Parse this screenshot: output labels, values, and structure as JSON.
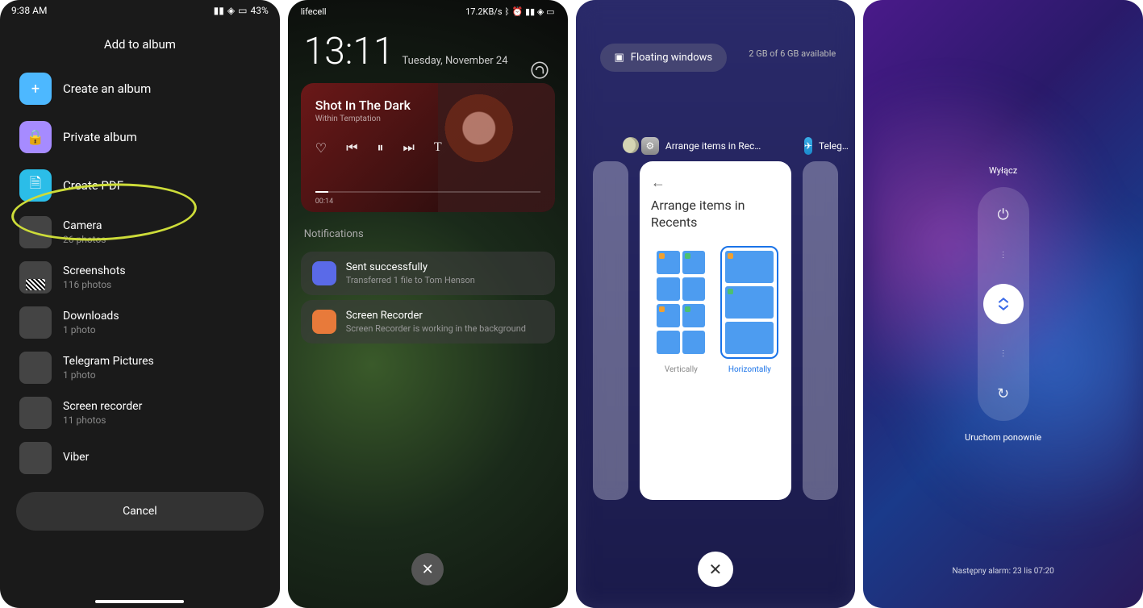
{
  "p1": {
    "status_time": "9:38 AM",
    "status_battery": "43%",
    "sheet_title": "Add to album",
    "create_album": "Create an album",
    "private_album": "Private album",
    "create_pdf": "Create PDF",
    "albums": [
      {
        "name": "Camera",
        "count": "26 photos"
      },
      {
        "name": "Screenshots",
        "count": "116 photos"
      },
      {
        "name": "Downloads",
        "count": "1 photo"
      },
      {
        "name": "Telegram Pictures",
        "count": "1 photo"
      },
      {
        "name": "Screen recorder",
        "count": "11 photos"
      },
      {
        "name": "Viber",
        "count": ""
      }
    ],
    "cancel": "Cancel"
  },
  "p2": {
    "carrier": "lifecell",
    "net_speed": "17.2KB/s",
    "clock": "13:11",
    "date": "Tuesday, November 24",
    "music": {
      "source": "",
      "song": "Shot In The Dark",
      "artist": "Within Temptation",
      "elapsed": "00:14"
    },
    "notif_section": "Notifications",
    "notifs": [
      {
        "title": "Sent successfully",
        "sub": "Transferred 1 file to Tom Henson"
      },
      {
        "title": "Screen Recorder",
        "sub": "Screen Recorder is working in the background"
      }
    ]
  },
  "p3": {
    "floating": "Floating windows",
    "memory": "2 GB of 6 GB available",
    "apps": [
      {
        "name": "Arrange items in Rec…"
      },
      {
        "name": "Teleg…"
      }
    ],
    "card": {
      "title": "Arrange items in Recents",
      "opt_vertical": "Vertically",
      "opt_horizontal": "Horizontally"
    }
  },
  "p4": {
    "power_off": "Wyłącz",
    "reboot": "Uruchom ponownie",
    "alarm": "Następny alarm: 23 lis 07:20"
  }
}
